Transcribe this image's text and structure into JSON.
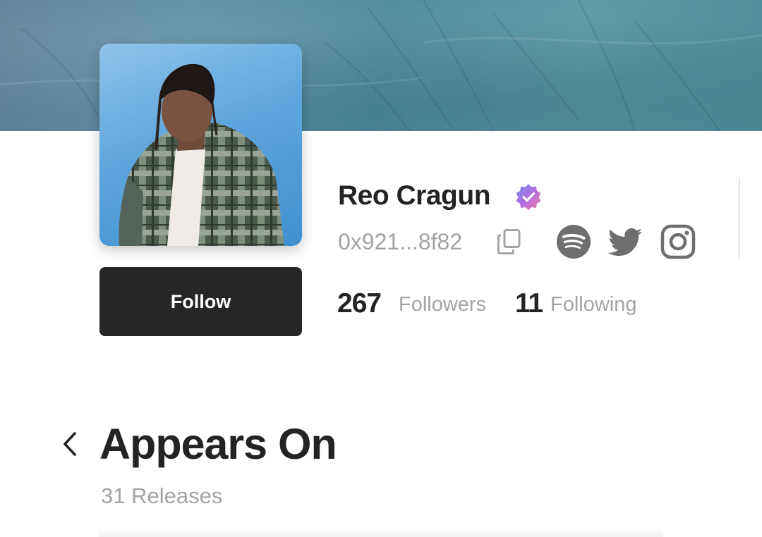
{
  "profile": {
    "name": "Reo Cragun",
    "verified": true,
    "wallet_address": "0x921...8f82",
    "follow_label": "Follow",
    "followers_count": "267",
    "followers_label": "Followers",
    "following_count": "11",
    "following_label": "Following",
    "social_links": [
      "spotify-icon",
      "twitter-icon",
      "instagram-icon"
    ]
  },
  "section": {
    "title": "Appears On",
    "subtitle": "31 Releases"
  },
  "colors": {
    "primary_text": "#232323",
    "muted_text": "#a3a3a3",
    "button_bg": "#262626",
    "verified_badge": "#a66ee0",
    "icon_gray": "#6e6e6e"
  }
}
